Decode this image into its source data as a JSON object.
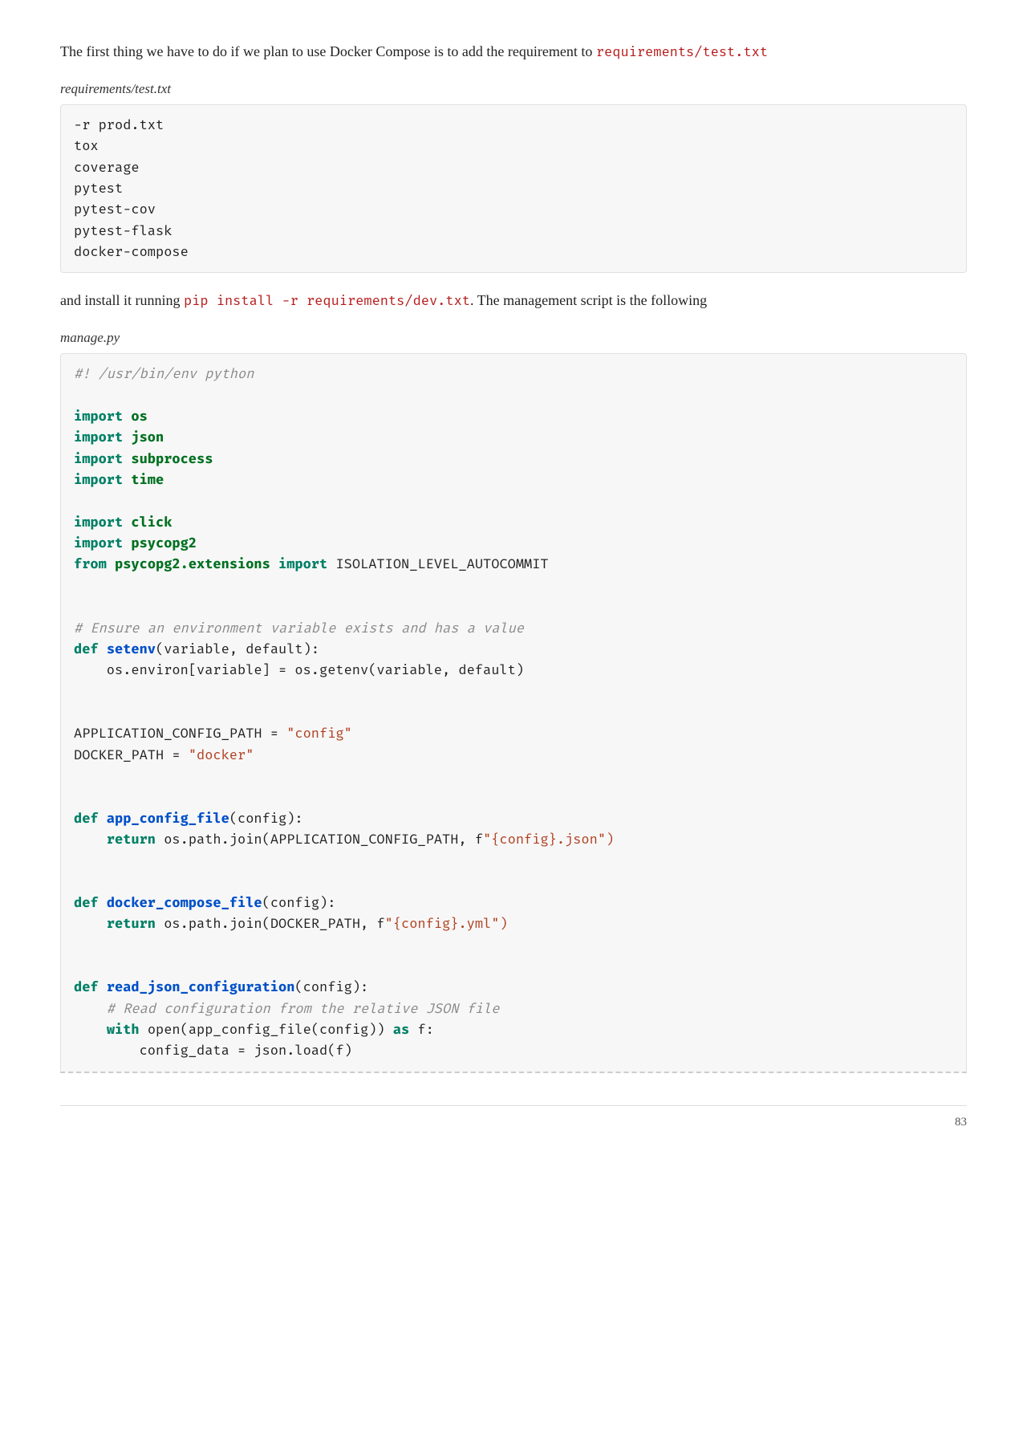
{
  "para1_prefix": "The first thing we have to do if we plan to use Docker Compose is to add the requirement to ",
  "para1_code": "requirements/test.txt",
  "caption1": "requirements/test.txt",
  "codeblock1": "-r prod.txt\ntox\ncoverage\npytest\npytest-cov\npytest-flask\ndocker-compose",
  "para2_prefix": "and install it running ",
  "para2_code": "pip install -r requirements/dev.txt",
  "para2_suffix": ". The management script is the following",
  "caption2": "manage.py",
  "py": {
    "shebang": "#! /usr/bin/env python",
    "import": "import",
    "from": "from",
    "def": "def",
    "return": "return",
    "with": "with",
    "as": "as",
    "mod_os": "os",
    "mod_json": "json",
    "mod_subprocess": "subprocess",
    "mod_time": "time",
    "mod_click": "click",
    "mod_psycopg2": "psycopg2",
    "mod_psy_ext": "psycopg2.extensions",
    "iso": "ISOLATION_LEVEL_AUTOCOMMIT",
    "comment1": "# Ensure an environment variable exists and has a value",
    "fn_setenv": "setenv",
    "setenv_args": "(variable, default):",
    "setenv_body": "    os.environ[variable] = os.getenv(variable, default)",
    "app_cfg_line": "APPLICATION_CONFIG_PATH = ",
    "str_config": "\"config\"",
    "docker_path_line": "DOCKER_PATH = ",
    "str_docker": "\"docker\"",
    "fn_appcfg": "app_config_file",
    "args_config": "(config):",
    "appcfg_ret_prefix": " os.path.join(APPLICATION_CONFIG_PATH, f",
    "appcfg_fstr": "\"{config}",
    "appcfg_ext": ".json",
    "close_q_paren": "\")",
    "fn_dcompose": "docker_compose_file",
    "dcompose_ret_prefix": " os.path.join(DOCKER_PATH, f",
    "dcompose_fstr": "\"{config}",
    "dcompose_ext": ".yml",
    "fn_readjson": "read_json_configuration",
    "comment2": "    # Read configuration from the relative JSON file",
    "open_call": " open(app_config_file(config)) ",
    "f_colon": " f:",
    "load_line": "        config_data = json.load(f)"
  },
  "page_number": "83"
}
